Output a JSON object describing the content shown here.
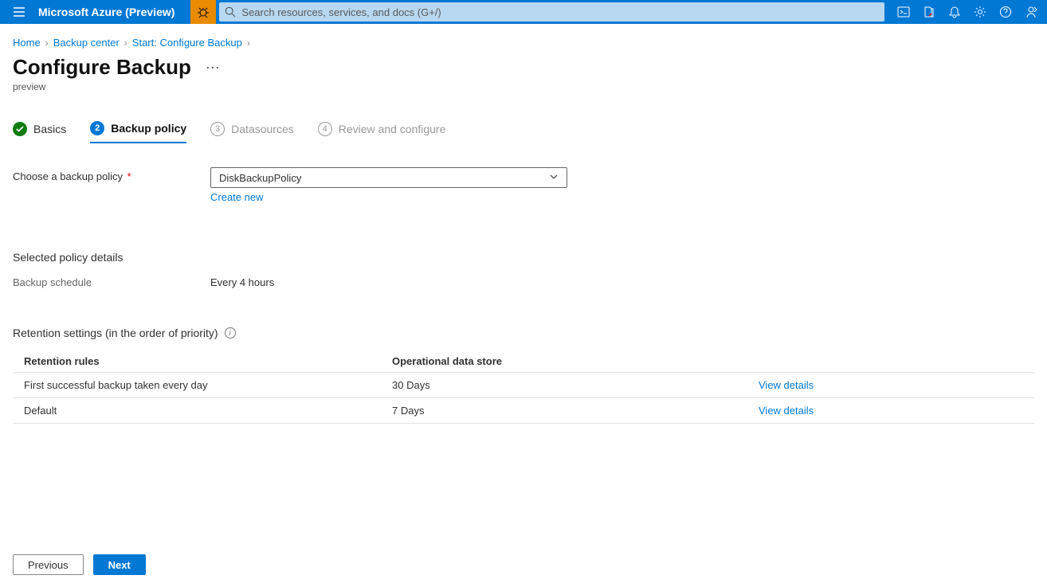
{
  "header": {
    "brand": "Microsoft Azure (Preview)",
    "search_placeholder": "Search resources, services, and docs (G+/)"
  },
  "breadcrumb": {
    "items": [
      "Home",
      "Backup center",
      "Start: Configure Backup"
    ]
  },
  "page": {
    "title": "Configure Backup",
    "subtitle": "preview"
  },
  "tabs": [
    {
      "label": "Basics",
      "state": "done"
    },
    {
      "label": "Backup policy",
      "state": "active",
      "num": "2"
    },
    {
      "label": "Datasources",
      "state": "pending",
      "num": "3"
    },
    {
      "label": "Review and configure",
      "state": "pending",
      "num": "4"
    }
  ],
  "policy": {
    "label": "Choose a backup policy",
    "selected": "DiskBackupPolicy",
    "create_link": "Create new"
  },
  "details": {
    "heading": "Selected policy details",
    "schedule_key": "Backup schedule",
    "schedule_val": "Every 4 hours"
  },
  "retention": {
    "heading": "Retention settings (in the order of priority)",
    "columns": [
      "Retention rules",
      "Operational data store"
    ],
    "view": "View details",
    "rows": [
      {
        "rule": "First successful backup taken every day",
        "store": "30 Days"
      },
      {
        "rule": "Default",
        "store": "7 Days"
      }
    ]
  },
  "footer": {
    "previous": "Previous",
    "next": "Next"
  }
}
